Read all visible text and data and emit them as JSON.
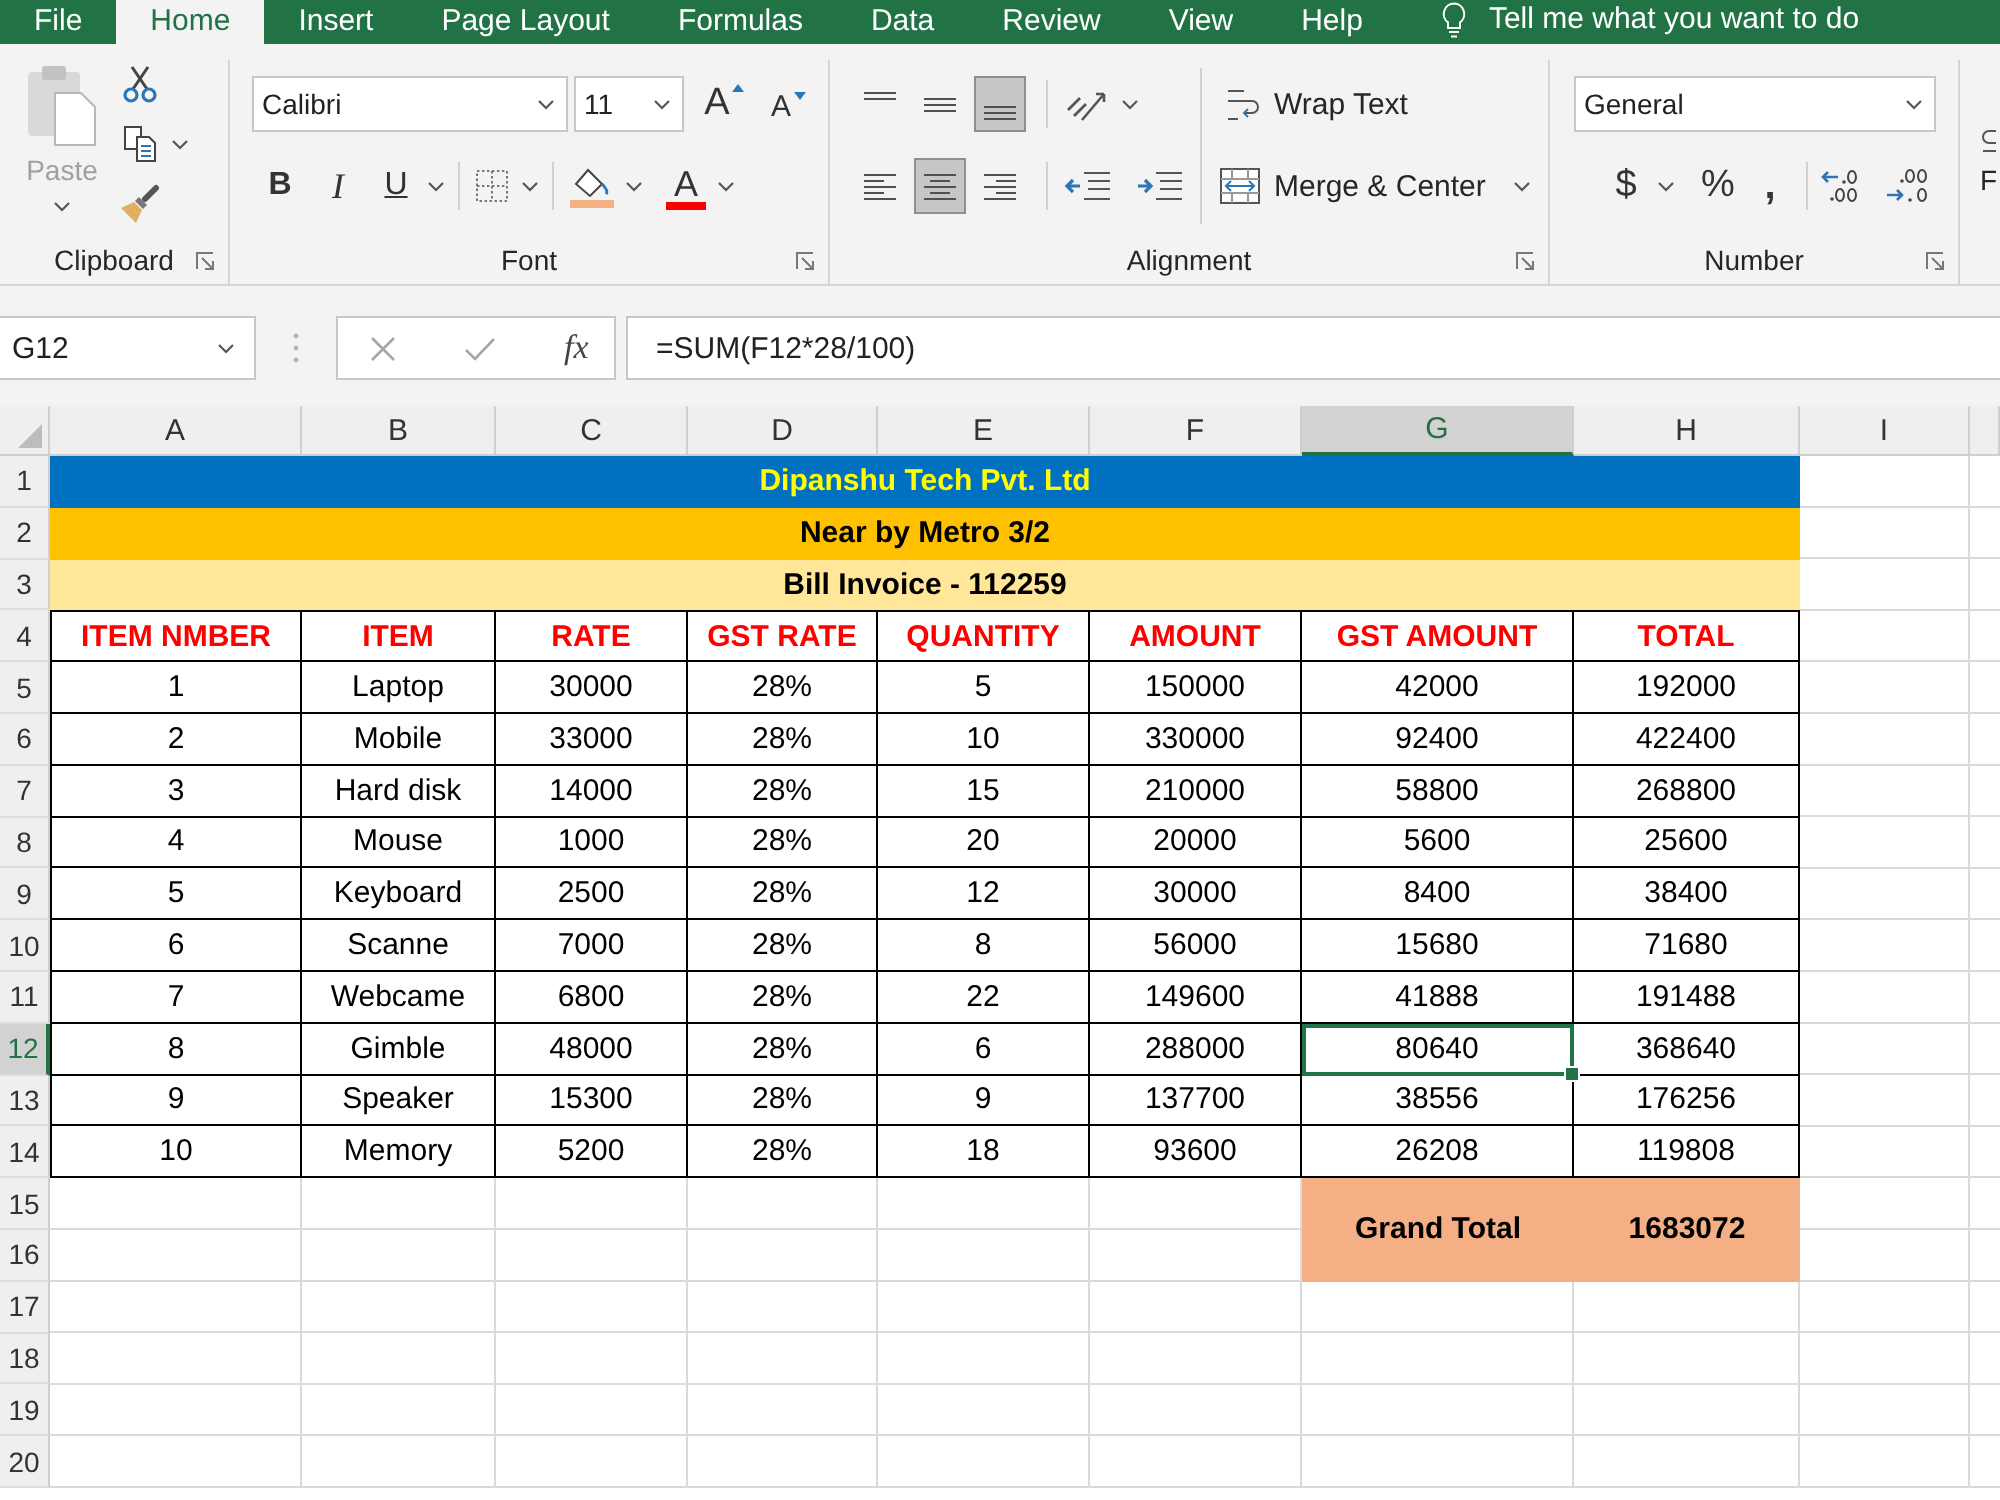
{
  "ribbon_tabs": [
    {
      "label": "File",
      "selected": false
    },
    {
      "label": "Home",
      "selected": true
    },
    {
      "label": "Insert",
      "selected": false
    },
    {
      "label": "Page Layout",
      "selected": false
    },
    {
      "label": "Formulas",
      "selected": false
    },
    {
      "label": "Data",
      "selected": false
    },
    {
      "label": "Review",
      "selected": false
    },
    {
      "label": "View",
      "selected": false
    },
    {
      "label": "Help",
      "selected": false
    }
  ],
  "tell_me": {
    "placeholder": "Tell me what you want to do"
  },
  "ribbon": {
    "clipboard": {
      "label": "Clipboard",
      "paste": {
        "label": "Paste",
        "disabled": true
      }
    },
    "font": {
      "label": "Font",
      "font_name": "Calibri",
      "font_size": "11",
      "grow_font": "A",
      "shrink_font": "A",
      "bold": "B",
      "italic": "I",
      "underline": "U",
      "font_color": "A"
    },
    "alignment": {
      "label": "Alignment",
      "vertical": [
        {
          "kind": "top",
          "selected": false
        },
        {
          "kind": "middle",
          "selected": false
        },
        {
          "kind": "bottom",
          "selected": true
        }
      ],
      "horizontal": [
        {
          "kind": "left",
          "selected": false
        },
        {
          "kind": "center",
          "selected": true
        },
        {
          "kind": "right",
          "selected": false
        }
      ],
      "wrap_text": "Wrap Text",
      "merge": "Merge & Center"
    },
    "number": {
      "label": "Number",
      "format": "General",
      "currency": "$",
      "percent": "%",
      "comma": ","
    },
    "cut_off_label": "F"
  },
  "formula_bar": {
    "name_box": "G12",
    "cancel": {
      "disabled": true
    },
    "enter": {
      "disabled": true
    },
    "function_button": "fx",
    "formula": "=SUM(F12*28/100)"
  },
  "sheet": {
    "columns": [
      {
        "label": "A",
        "selected": false
      },
      {
        "label": "B",
        "selected": false
      },
      {
        "label": "C",
        "selected": false
      },
      {
        "label": "D",
        "selected": false
      },
      {
        "label": "E",
        "selected": false
      },
      {
        "label": "F",
        "selected": false
      },
      {
        "label": "G",
        "selected": true
      },
      {
        "label": "H",
        "selected": false
      },
      {
        "label": "I",
        "selected": false
      }
    ],
    "row_numbers": [
      {
        "label": "1",
        "selected": false
      },
      {
        "label": "2",
        "selected": false
      },
      {
        "label": "3",
        "selected": false
      },
      {
        "label": "4",
        "selected": false
      },
      {
        "label": "5",
        "selected": false
      },
      {
        "label": "6",
        "selected": false
      },
      {
        "label": "7",
        "selected": false
      },
      {
        "label": "8",
        "selected": false
      },
      {
        "label": "9",
        "selected": false
      },
      {
        "label": "10",
        "selected": false
      },
      {
        "label": "11",
        "selected": false
      },
      {
        "label": "12",
        "selected": true
      },
      {
        "label": "13",
        "selected": false
      },
      {
        "label": "14",
        "selected": false
      },
      {
        "label": "15",
        "selected": false
      },
      {
        "label": "16",
        "selected": false
      },
      {
        "label": "17",
        "selected": false
      },
      {
        "label": "18",
        "selected": false
      },
      {
        "label": "19",
        "selected": false
      },
      {
        "label": "20",
        "selected": false
      }
    ],
    "banners": [
      {
        "text": "Dipanshu Tech Pvt. Ltd",
        "kind": "highlighted",
        "color": "#0070c0"
      },
      {
        "text": "Near by Metro 3/2",
        "kind": "plain",
        "color": "#ffc000"
      },
      {
        "text": "Bill Invoice - 112259",
        "kind": "plain",
        "color": "#ffe699"
      }
    ],
    "headers": [
      "ITEM NMBER",
      "ITEM",
      "RATE",
      "GST RATE",
      "QUANTITY",
      "AMOUNT",
      "GST AMOUNT",
      "TOTAL"
    ],
    "rows": [
      {
        "cells": [
          {
            "text": "1",
            "selected": false
          },
          {
            "text": "Laptop",
            "selected": false
          },
          {
            "text": "30000",
            "selected": false
          },
          {
            "text": "28%",
            "selected": false
          },
          {
            "text": "5",
            "selected": false
          },
          {
            "text": "150000",
            "selected": false
          },
          {
            "text": "42000",
            "selected": false
          },
          {
            "text": "192000",
            "selected": false
          }
        ]
      },
      {
        "cells": [
          {
            "text": "2",
            "selected": false
          },
          {
            "text": "Mobile",
            "selected": false
          },
          {
            "text": "33000",
            "selected": false
          },
          {
            "text": "28%",
            "selected": false
          },
          {
            "text": "10",
            "selected": false
          },
          {
            "text": "330000",
            "selected": false
          },
          {
            "text": "92400",
            "selected": false
          },
          {
            "text": "422400",
            "selected": false
          }
        ]
      },
      {
        "cells": [
          {
            "text": "3",
            "selected": false
          },
          {
            "text": "Hard disk",
            "selected": false
          },
          {
            "text": "14000",
            "selected": false
          },
          {
            "text": "28%",
            "selected": false
          },
          {
            "text": "15",
            "selected": false
          },
          {
            "text": "210000",
            "selected": false
          },
          {
            "text": "58800",
            "selected": false
          },
          {
            "text": "268800",
            "selected": false
          }
        ]
      },
      {
        "cells": [
          {
            "text": "4",
            "selected": false
          },
          {
            "text": "Mouse",
            "selected": false
          },
          {
            "text": "1000",
            "selected": false
          },
          {
            "text": "28%",
            "selected": false
          },
          {
            "text": "20",
            "selected": false
          },
          {
            "text": "20000",
            "selected": false
          },
          {
            "text": "5600",
            "selected": false
          },
          {
            "text": "25600",
            "selected": false
          }
        ]
      },
      {
        "cells": [
          {
            "text": "5",
            "selected": false
          },
          {
            "text": "Keyboard",
            "selected": false
          },
          {
            "text": "2500",
            "selected": false
          },
          {
            "text": "28%",
            "selected": false
          },
          {
            "text": "12",
            "selected": false
          },
          {
            "text": "30000",
            "selected": false
          },
          {
            "text": "8400",
            "selected": false
          },
          {
            "text": "38400",
            "selected": false
          }
        ]
      },
      {
        "cells": [
          {
            "text": "6",
            "selected": false
          },
          {
            "text": "Scanne",
            "selected": false
          },
          {
            "text": "7000",
            "selected": false
          },
          {
            "text": "28%",
            "selected": false
          },
          {
            "text": "8",
            "selected": false
          },
          {
            "text": "56000",
            "selected": false
          },
          {
            "text": "15680",
            "selected": false
          },
          {
            "text": "71680",
            "selected": false
          }
        ]
      },
      {
        "cells": [
          {
            "text": "7",
            "selected": false
          },
          {
            "text": "Webcame",
            "selected": false
          },
          {
            "text": "6800",
            "selected": false
          },
          {
            "text": "28%",
            "selected": false
          },
          {
            "text": "22",
            "selected": false
          },
          {
            "text": "149600",
            "selected": false
          },
          {
            "text": "41888",
            "selected": false
          },
          {
            "text": "191488",
            "selected": false
          }
        ]
      },
      {
        "cells": [
          {
            "text": "8",
            "selected": false
          },
          {
            "text": "Gimble",
            "selected": false
          },
          {
            "text": "48000",
            "selected": false
          },
          {
            "text": "28%",
            "selected": false
          },
          {
            "text": "6",
            "selected": false
          },
          {
            "text": "288000",
            "selected": false
          },
          {
            "text": "80640",
            "selected": true
          },
          {
            "text": "368640",
            "selected": false
          }
        ]
      },
      {
        "cells": [
          {
            "text": "9",
            "selected": false
          },
          {
            "text": "Speaker",
            "selected": false
          },
          {
            "text": "15300",
            "selected": false
          },
          {
            "text": "28%",
            "selected": false
          },
          {
            "text": "9",
            "selected": false
          },
          {
            "text": "137700",
            "selected": false
          },
          {
            "text": "38556",
            "selected": false
          },
          {
            "text": "176256",
            "selected": false
          }
        ]
      },
      {
        "cells": [
          {
            "text": "10",
            "selected": false
          },
          {
            "text": "Memory",
            "selected": false
          },
          {
            "text": "5200",
            "selected": false
          },
          {
            "text": "28%",
            "selected": false
          },
          {
            "text": "18",
            "selected": false
          },
          {
            "text": "93600",
            "selected": false
          },
          {
            "text": "26208",
            "selected": false
          },
          {
            "text": "119808",
            "selected": false
          }
        ]
      }
    ],
    "grand_total": {
      "label": "Grand Total",
      "value": "1683072"
    }
  }
}
